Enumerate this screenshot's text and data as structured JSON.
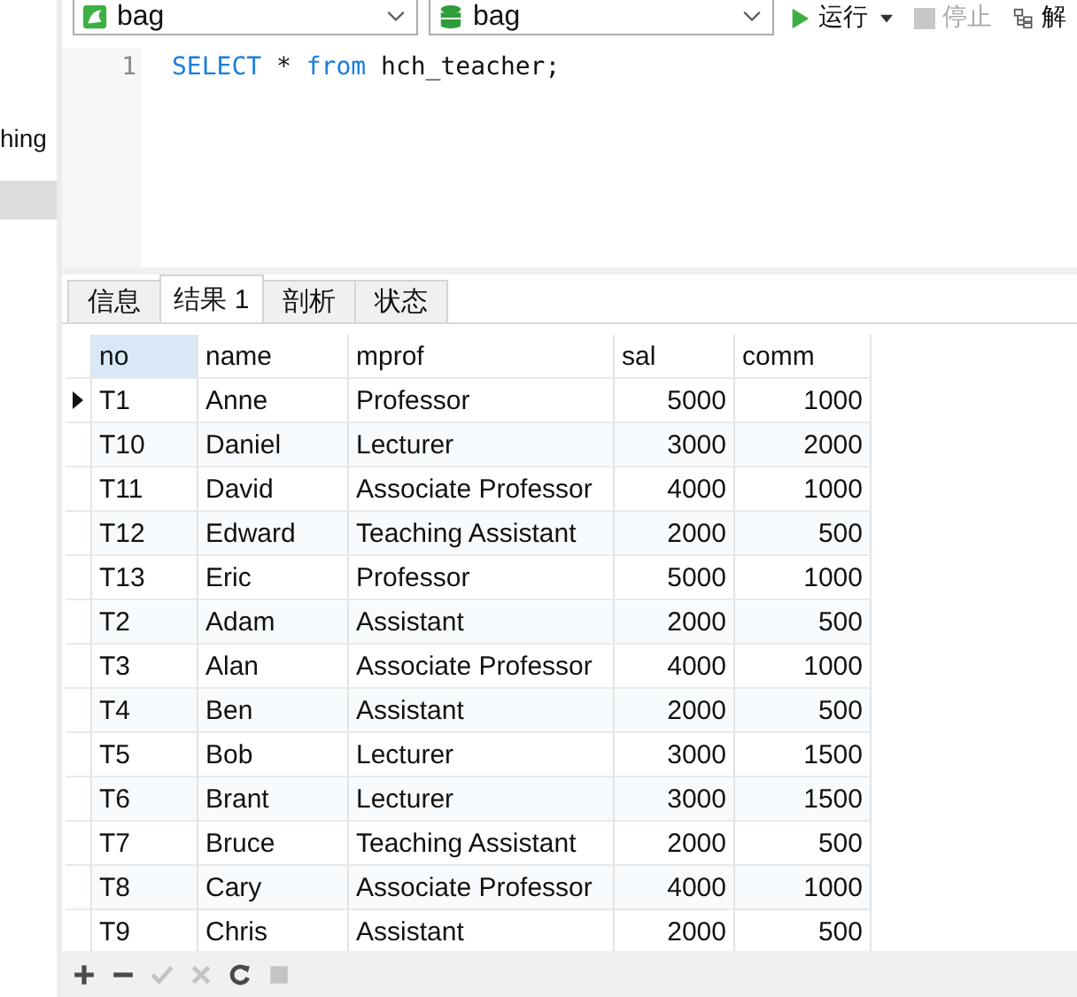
{
  "sidebar": {
    "items": [
      {
        "label": "hing",
        "selected": false
      }
    ]
  },
  "toolbar": {
    "connection": "bag",
    "database": "bag",
    "run": "运行",
    "stop": "停止",
    "explain": "解"
  },
  "editor": {
    "lines": [
      {
        "number": "1",
        "keyword1": "SELECT",
        "star": "*",
        "keyword2": "from",
        "table": "hch_teacher;"
      }
    ]
  },
  "tabs": [
    {
      "label": "信息",
      "selected": false
    },
    {
      "label": "结果 1",
      "selected": true
    },
    {
      "label": "剖析",
      "selected": false
    },
    {
      "label": "状态",
      "selected": false
    }
  ],
  "table": {
    "columns": [
      {
        "label": "no",
        "selected": true
      },
      {
        "label": "name",
        "selected": false
      },
      {
        "label": "mprof",
        "selected": false
      },
      {
        "label": "sal",
        "selected": false
      },
      {
        "label": "comm",
        "selected": false
      }
    ],
    "rows": [
      {
        "selected": true,
        "cells": [
          "T1",
          "Anne",
          "Professor",
          "5000",
          "1000"
        ]
      },
      {
        "selected": false,
        "cells": [
          "T10",
          "Daniel",
          "Lecturer",
          "3000",
          "2000"
        ]
      },
      {
        "selected": false,
        "cells": [
          "T11",
          "David",
          "Associate Professor",
          "4000",
          "1000"
        ]
      },
      {
        "selected": false,
        "cells": [
          "T12",
          "Edward",
          "Teaching Assistant",
          "2000",
          "500"
        ]
      },
      {
        "selected": false,
        "cells": [
          "T13",
          "Eric",
          "Professor",
          "5000",
          "1000"
        ]
      },
      {
        "selected": false,
        "cells": [
          "T2",
          "Adam",
          "Assistant",
          "2000",
          "500"
        ]
      },
      {
        "selected": false,
        "cells": [
          "T3",
          "Alan",
          "Associate Professor",
          "4000",
          "1000"
        ]
      },
      {
        "selected": false,
        "cells": [
          "T4",
          "Ben",
          "Assistant",
          "2000",
          "500"
        ]
      },
      {
        "selected": false,
        "cells": [
          "T5",
          "Bob",
          "Lecturer",
          "3000",
          "1500"
        ]
      },
      {
        "selected": false,
        "cells": [
          "T6",
          "Brant",
          "Lecturer",
          "3000",
          "1500"
        ]
      },
      {
        "selected": false,
        "cells": [
          "T7",
          "Bruce",
          "Teaching Assistant",
          "2000",
          "500"
        ]
      },
      {
        "selected": false,
        "cells": [
          "T8",
          "Cary",
          "Associate Professor",
          "4000",
          "1000"
        ]
      },
      {
        "selected": false,
        "cells": [
          "T9",
          "Chris",
          "Assistant",
          "2000",
          "500"
        ]
      }
    ]
  },
  "grid_toolbar": [
    {
      "kind": "add",
      "disabled": false
    },
    {
      "kind": "remove",
      "disabled": false
    },
    {
      "kind": "apply",
      "disabled": true
    },
    {
      "kind": "discard",
      "disabled": true
    },
    {
      "kind": "refresh",
      "disabled": false
    },
    {
      "kind": "stop",
      "disabled": true
    }
  ]
}
